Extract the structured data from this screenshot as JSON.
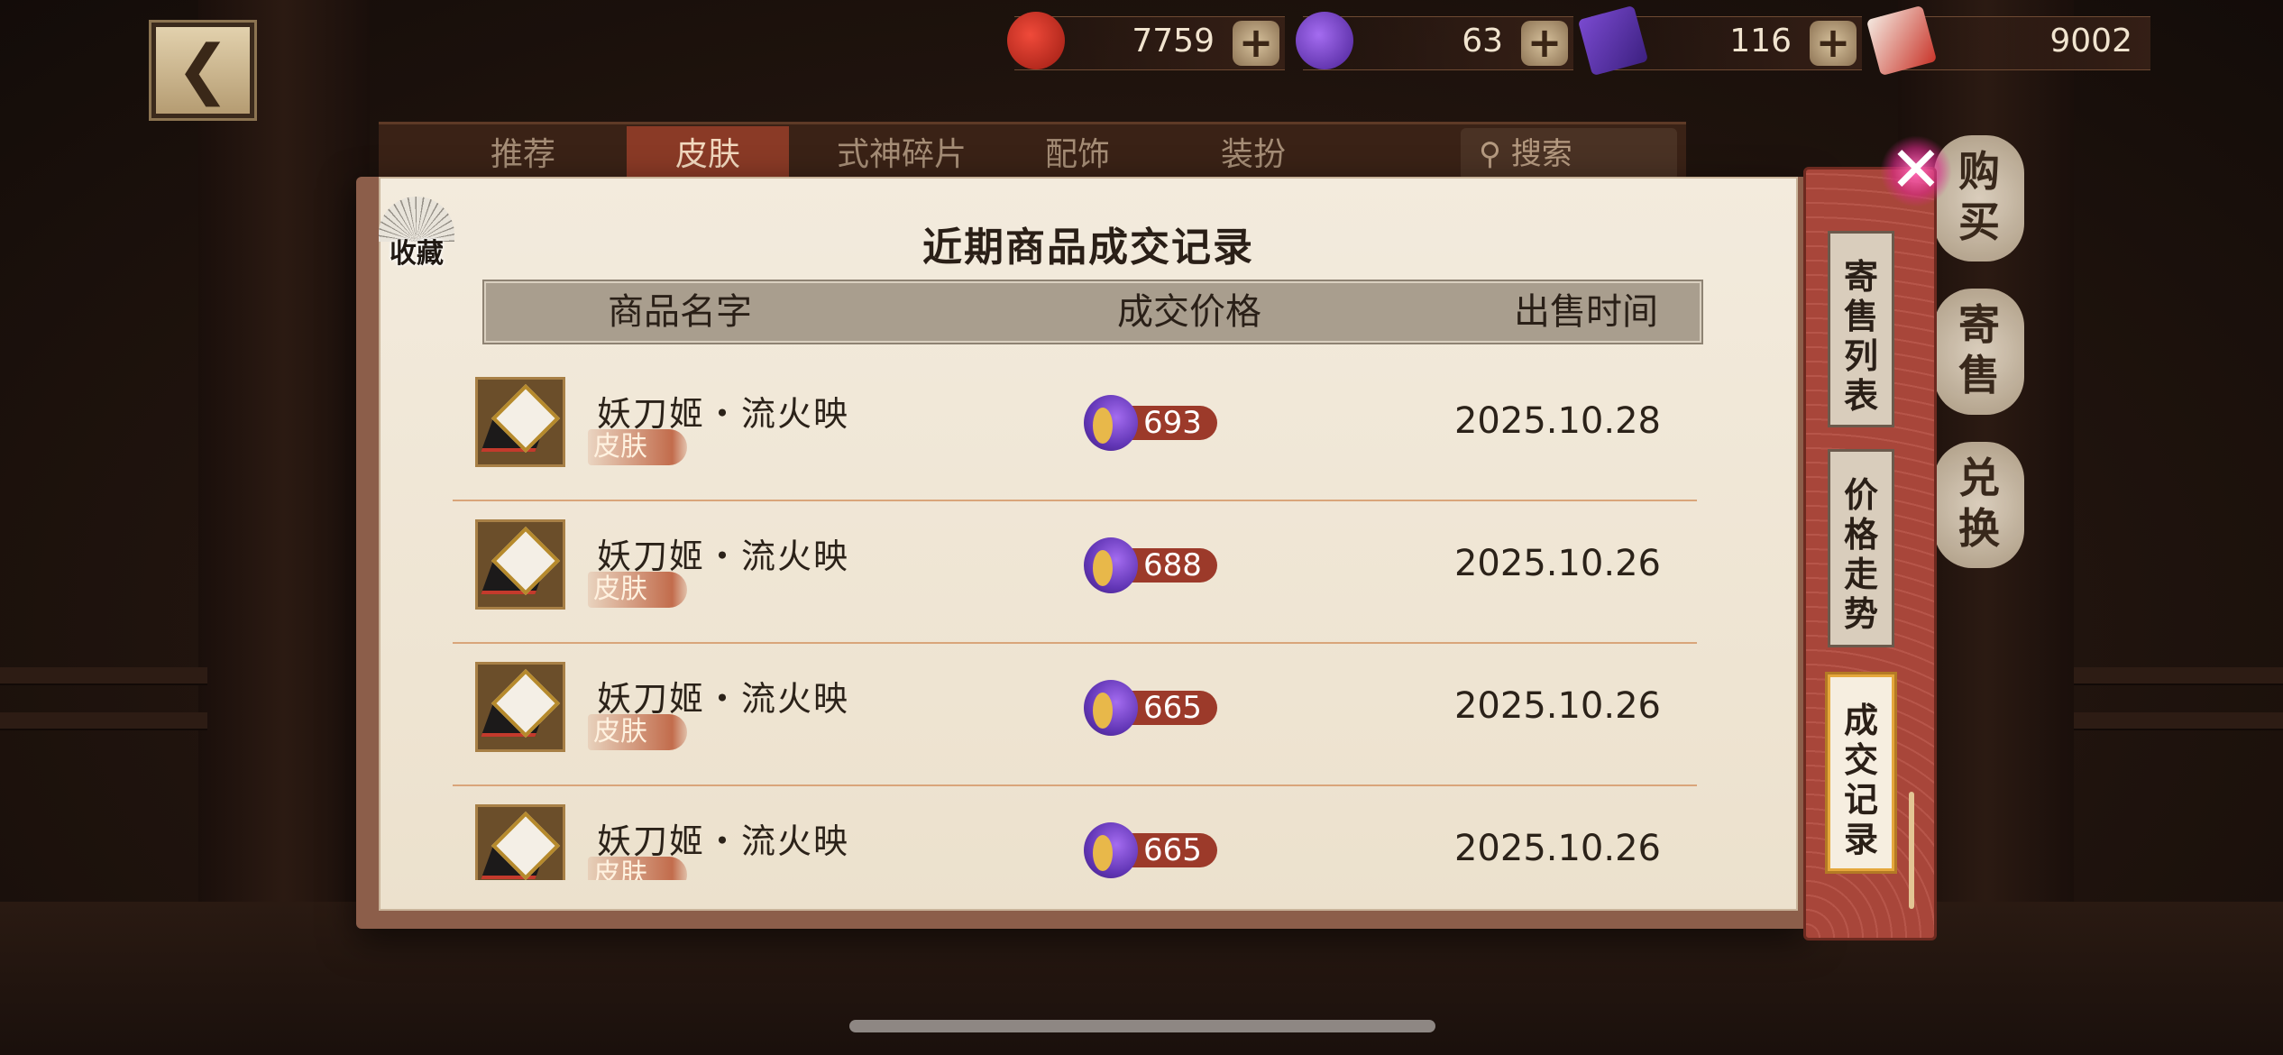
{
  "currencies": [
    {
      "icon": "red-magatama-icon",
      "value": "7759"
    },
    {
      "icon": "purple-magatama-icon",
      "value": "63"
    },
    {
      "icon": "purple-ticket-icon",
      "value": "116"
    },
    {
      "icon": "red-charm-icon",
      "value": "9002"
    }
  ],
  "tabs": [
    {
      "label": "推荐",
      "active": false
    },
    {
      "label": "皮肤",
      "active": true
    },
    {
      "label": "式神碎片",
      "active": false
    },
    {
      "label": "配饰",
      "active": false
    },
    {
      "label": "装扮",
      "active": false
    }
  ],
  "search": {
    "label": "搜索"
  },
  "right_menu": [
    "购买",
    "寄售",
    "兑换"
  ],
  "dialog": {
    "title": "近期商品成交记录",
    "favorite_label": "收藏",
    "headers": {
      "name": "商品名字",
      "price": "成交价格",
      "time": "出售时间"
    },
    "rows": [
      {
        "name": "妖刀姬・流火映",
        "tag": "皮肤",
        "price": "693",
        "date": "2025.10.28"
      },
      {
        "name": "妖刀姬・流火映",
        "tag": "皮肤",
        "price": "688",
        "date": "2025.10.26"
      },
      {
        "name": "妖刀姬・流火映",
        "tag": "皮肤",
        "price": "665",
        "date": "2025.10.26"
      },
      {
        "name": "妖刀姬・流火映",
        "tag": "皮肤",
        "price": "665",
        "date": "2025.10.26"
      }
    ]
  },
  "side_tabs": [
    {
      "label": "寄售列表",
      "active": false
    },
    {
      "label": "价格走势",
      "active": false
    },
    {
      "label": "成交记录",
      "active": true
    }
  ],
  "colors": {
    "accent_red": "#a8463a",
    "paper": "#f3ebdd",
    "price_brush": "#9c3a2a",
    "active_tab_border": "#e5a73b"
  }
}
